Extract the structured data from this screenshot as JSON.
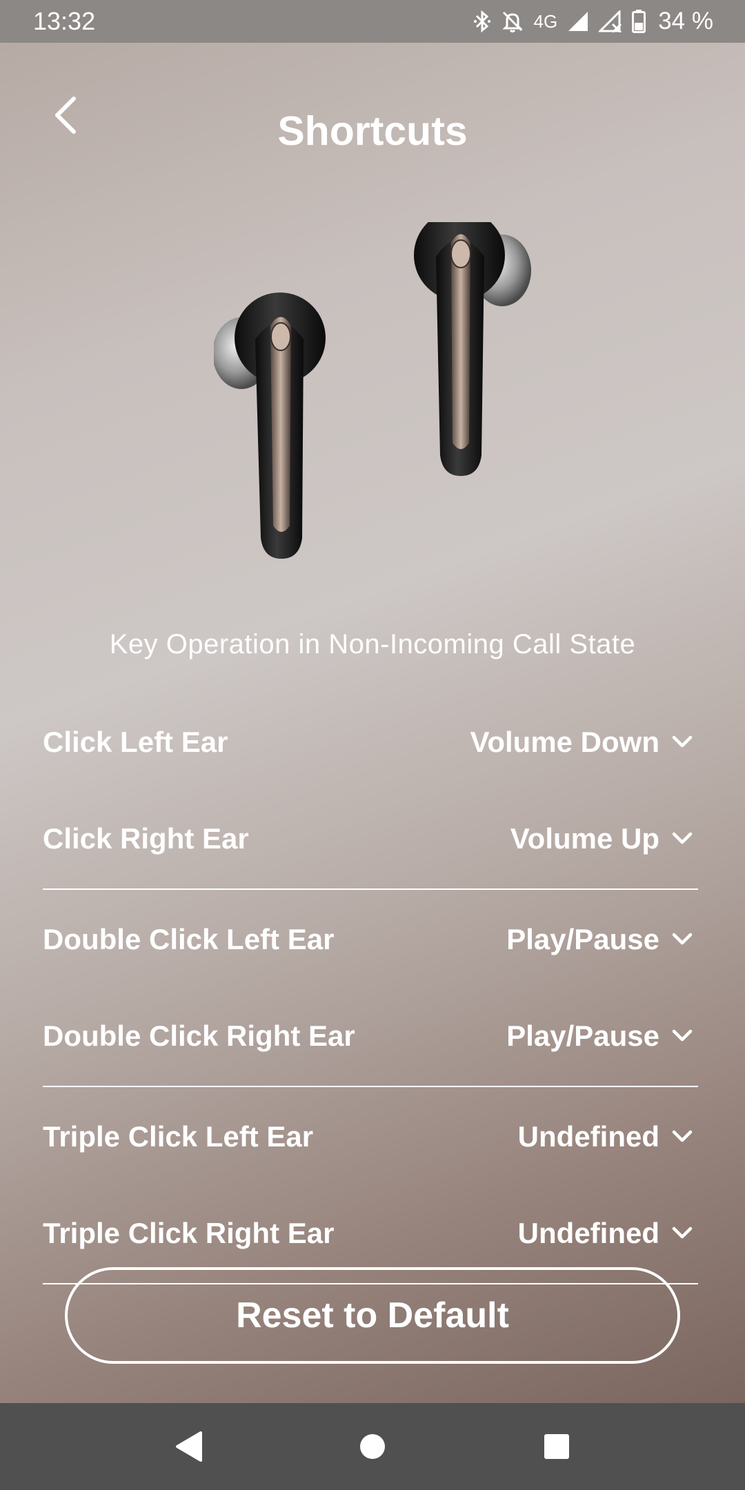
{
  "status_bar": {
    "time": "13:32",
    "network": "4G",
    "battery": "34 %",
    "icons": [
      "bluetooth-icon",
      "mute-notification-icon",
      "signal-icon",
      "no-signal-icon",
      "battery-icon"
    ]
  },
  "header": {
    "title": "Shortcuts",
    "back_icon": "chevron-left-icon"
  },
  "section": {
    "title": "Key Operation in Non-Incoming Call State"
  },
  "shortcuts": [
    {
      "label": "Click Left Ear",
      "value": "Volume Down"
    },
    {
      "label": "Click Right Ear",
      "value": "Volume Up"
    },
    {
      "label": "Double Click Left Ear",
      "value": "Play/Pause"
    },
    {
      "label": "Double Click Right Ear",
      "value": "Play/Pause"
    },
    {
      "label": "Triple Click Left Ear",
      "value": "Undefined"
    },
    {
      "label": "Triple Click Right Ear",
      "value": "Undefined"
    }
  ],
  "reset_button": "Reset to Default",
  "colors": {
    "accent": "#ffffff",
    "background_top": "#b6aaa4",
    "background_bottom": "#7a665e",
    "status_bar": "#8c8886",
    "nav_bar": "#505050"
  }
}
